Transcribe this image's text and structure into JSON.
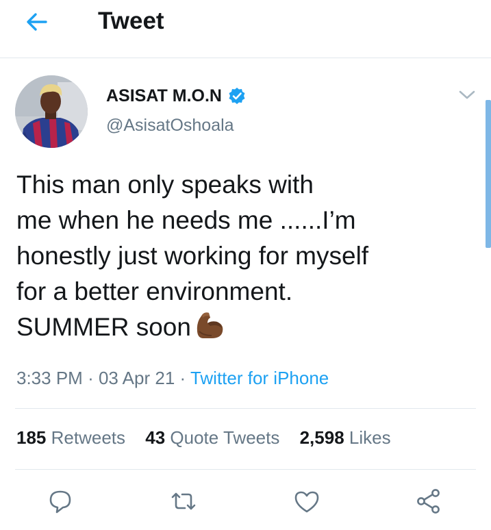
{
  "header": {
    "title": "Tweet",
    "back_icon": "arrow-left-icon",
    "accent_color": "#1da1f2"
  },
  "tweet": {
    "author": {
      "name": "ASISAT M.O.N",
      "handle": "@AsisatOshoala",
      "verified": true
    },
    "text_lines": [
      "This man only speaks with",
      "me when he needs me ......I’m",
      "honestly just working for myself",
      "for a better environment.",
      "SUMMER soon"
    ],
    "emoji": "flexed-biceps-medium-dark-skin-tone",
    "time": "3:33 PM",
    "date": "03 Apr 21",
    "separator": "·",
    "source": "Twitter for iPhone"
  },
  "stats": [
    {
      "count": "185",
      "label": "Retweets"
    },
    {
      "count": "43",
      "label": "Quote Tweets"
    },
    {
      "count": "2,598",
      "label": "Likes"
    }
  ],
  "actions": [
    {
      "name": "reply",
      "icon": "reply-icon"
    },
    {
      "name": "retweet",
      "icon": "retweet-icon"
    },
    {
      "name": "like",
      "icon": "heart-icon"
    },
    {
      "name": "share",
      "icon": "share-icon"
    }
  ],
  "colors": {
    "text_primary": "#14171a",
    "text_secondary": "#657786",
    "divider": "#e1e8ed",
    "icon": "#657786",
    "verified": "#1da1f2"
  }
}
